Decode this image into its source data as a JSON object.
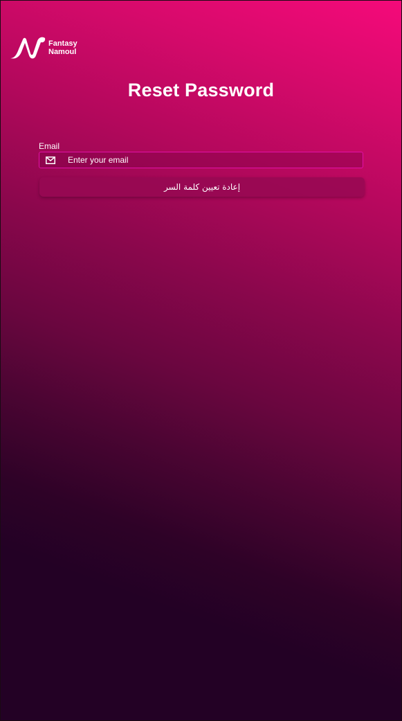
{
  "brand": {
    "line1": "Fantasy",
    "line2": "Namoul",
    "logo_icon": "brand-n-logo-icon"
  },
  "page": {
    "title": "Reset Password"
  },
  "form": {
    "email_label": "Email",
    "email_placeholder": "Enter your email",
    "email_value": "",
    "email_icon": "mail-icon",
    "submit_label": "إعادة تعيين كلمة السر"
  },
  "colors": {
    "gradient_top": "#f50a7a",
    "gradient_bottom": "#230125",
    "input_border": "#e310a8",
    "button_bg": "#960852",
    "text": "#ffffff"
  }
}
